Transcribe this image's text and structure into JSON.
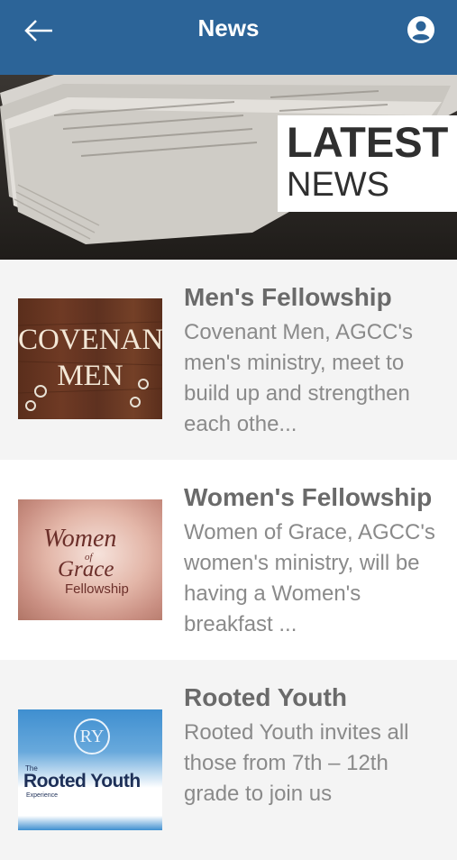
{
  "appbar": {
    "title": "News",
    "back_icon": "arrow-left-icon",
    "account_icon": "account-circle-icon",
    "background": "#2c6498"
  },
  "banner": {
    "line1": "LATEST",
    "line2": "NEWS"
  },
  "news": [
    {
      "title": "Men's Fellowship",
      "description": "Covenant Men, AGCC's men's ministry, meet to build up and strengthen each othe...",
      "thumb_line1": "COVENANT",
      "thumb_line2": "MEN"
    },
    {
      "title": "Women's Fellowship",
      "description": "Women of Grace, AGCC's women's ministry, will be having a Women's breakfast ...",
      "thumb_line1": "Women",
      "thumb_line2": "of",
      "thumb_line3": "Grace",
      "thumb_line4": "Fellowship"
    },
    {
      "title": "Rooted Youth",
      "description": "Rooted Youth invites all those from 7th – 12th grade to join us",
      "thumb_mark": "RY",
      "thumb_small": "The",
      "thumb_line1": "Rooted Youth",
      "thumb_line2": "Experience"
    }
  ]
}
